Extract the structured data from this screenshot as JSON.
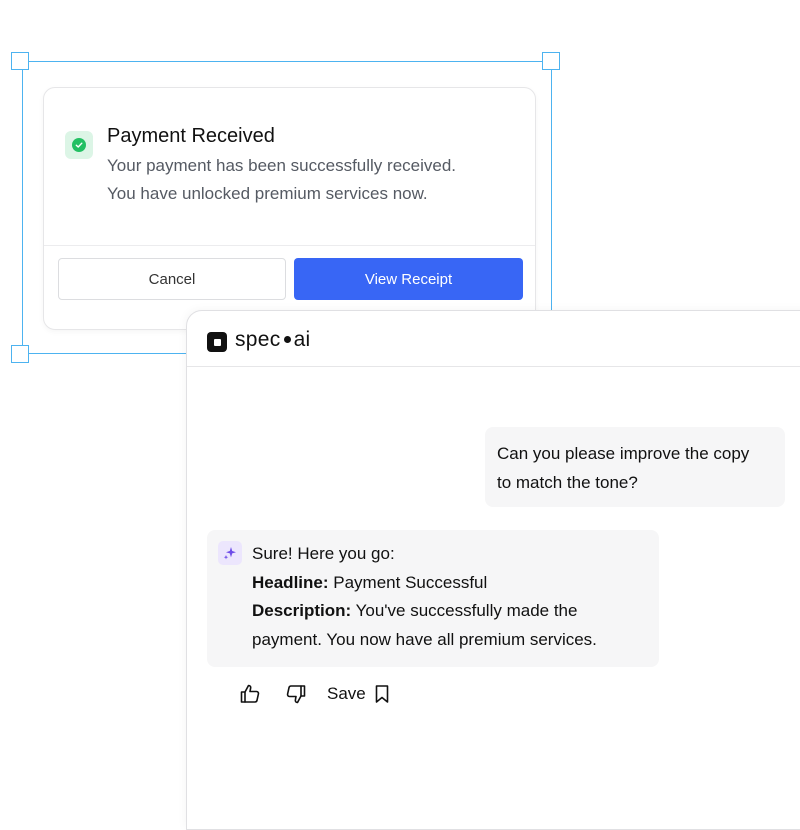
{
  "payment_card": {
    "title": "Payment Received",
    "description_line1": "Your payment has been successfully received.",
    "description_line2": "You have unlocked premium services now.",
    "cancel_label": "Cancel",
    "view_receipt_label": "View Receipt",
    "icon": "check-circle-icon"
  },
  "chat": {
    "brand_left": "spec",
    "brand_right": "ai",
    "user_message_line1": "Can you please improve the copy",
    "user_message_line2": "to match the tone?",
    "ai_intro": "Sure! Here you go:",
    "headline_label": "Headline:",
    "headline_value": " Payment Successful",
    "description_label": "Description:",
    "description_value_line1": " You've successfully made the",
    "description_value_line2": "payment. You now have all premium services.",
    "save_label": "Save"
  },
  "colors": {
    "accent": "#3866f5",
    "selection": "#4db3f0",
    "success": "#22c063",
    "sparkle": "#6d4ce8"
  }
}
